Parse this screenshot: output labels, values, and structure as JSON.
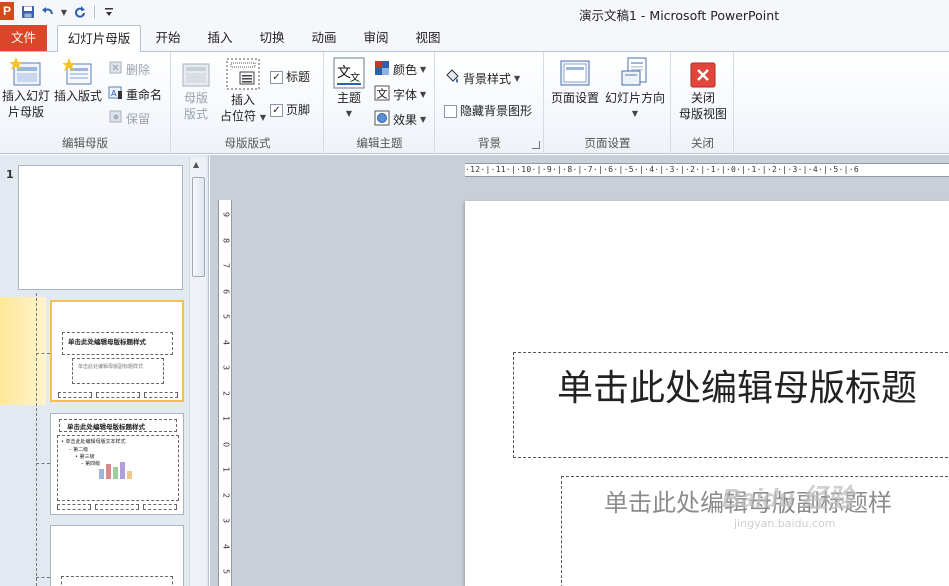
{
  "window": {
    "title": "演示文稿1  -  Microsoft PowerPoint",
    "app_logo": "P"
  },
  "quick_access": {
    "icons": [
      "save-icon",
      "undo-icon",
      "redo-icon",
      "customize-icon"
    ]
  },
  "tabs": {
    "file": "文件",
    "items": [
      {
        "label": "幻灯片母版",
        "active": true
      },
      {
        "label": "开始"
      },
      {
        "label": "插入"
      },
      {
        "label": "切换"
      },
      {
        "label": "动画"
      },
      {
        "label": "审阅"
      },
      {
        "label": "视图"
      }
    ]
  },
  "ribbon": {
    "group_edit_master": {
      "label": "编辑母版",
      "insert_slide_master_line1": "插入幻灯",
      "insert_slide_master_line2": "片母版",
      "insert_layout": "插入版式",
      "delete": "删除",
      "rename": "重命名",
      "preserve": "保留"
    },
    "group_master_layout": {
      "label": "母版版式",
      "master_layout_line1": "母版",
      "master_layout_line2": "版式",
      "insert_placeholder_line1": "插入",
      "insert_placeholder_line2": "占位符",
      "title_checkbox": "标题",
      "footer_checkbox": "页脚",
      "title_checked": true,
      "footer_checked": true
    },
    "group_edit_theme": {
      "label": "编辑主题",
      "themes": "主题",
      "colors": "颜色",
      "fonts": "字体",
      "effects": "效果"
    },
    "group_background": {
      "label": "背景",
      "background_styles": "背景样式",
      "hide_background_graphics": "隐藏背景图形"
    },
    "group_page_setup": {
      "label": "页面设置",
      "page_setup": "页面设置",
      "slide_orientation": "幻灯片方向"
    },
    "group_close": {
      "label": "关闭",
      "close_master_line1": "关闭",
      "close_master_line2": "母版视图"
    }
  },
  "thumbnails": {
    "slide_number": "1",
    "layout1_title": "单击此处编辑母版标题样式",
    "layout1_sub": "单击此处编辑母版副标题样式",
    "layout2_title": "单击此处编辑母版标题样式",
    "layout2_text": "• 单击此处编辑母版文本样式",
    "layout2_l2": "– 第二级",
    "layout2_l3": "• 第三级",
    "layout2_l4": "– 第四级"
  },
  "ruler": {
    "horizontal": "·12·|·11·|·10·|·9·|·8·|·7·|·6·|·5·|·4·|·3·|·2·|·1·|·0·|·1·|·2·|·3·|·4·|·5·|·6",
    "vertical_numbers": [
      "9",
      "8",
      "7",
      "6",
      "5",
      "4",
      "3",
      "2",
      "1",
      "0",
      "1",
      "2",
      "3",
      "4",
      "5"
    ]
  },
  "slide": {
    "title_placeholder": "单击此处编辑母版标题",
    "subtitle_placeholder": "单击此处编辑母版副标题样"
  },
  "watermark": {
    "main": "Baidu 经验",
    "sub": "jingyan.baidu.com"
  }
}
